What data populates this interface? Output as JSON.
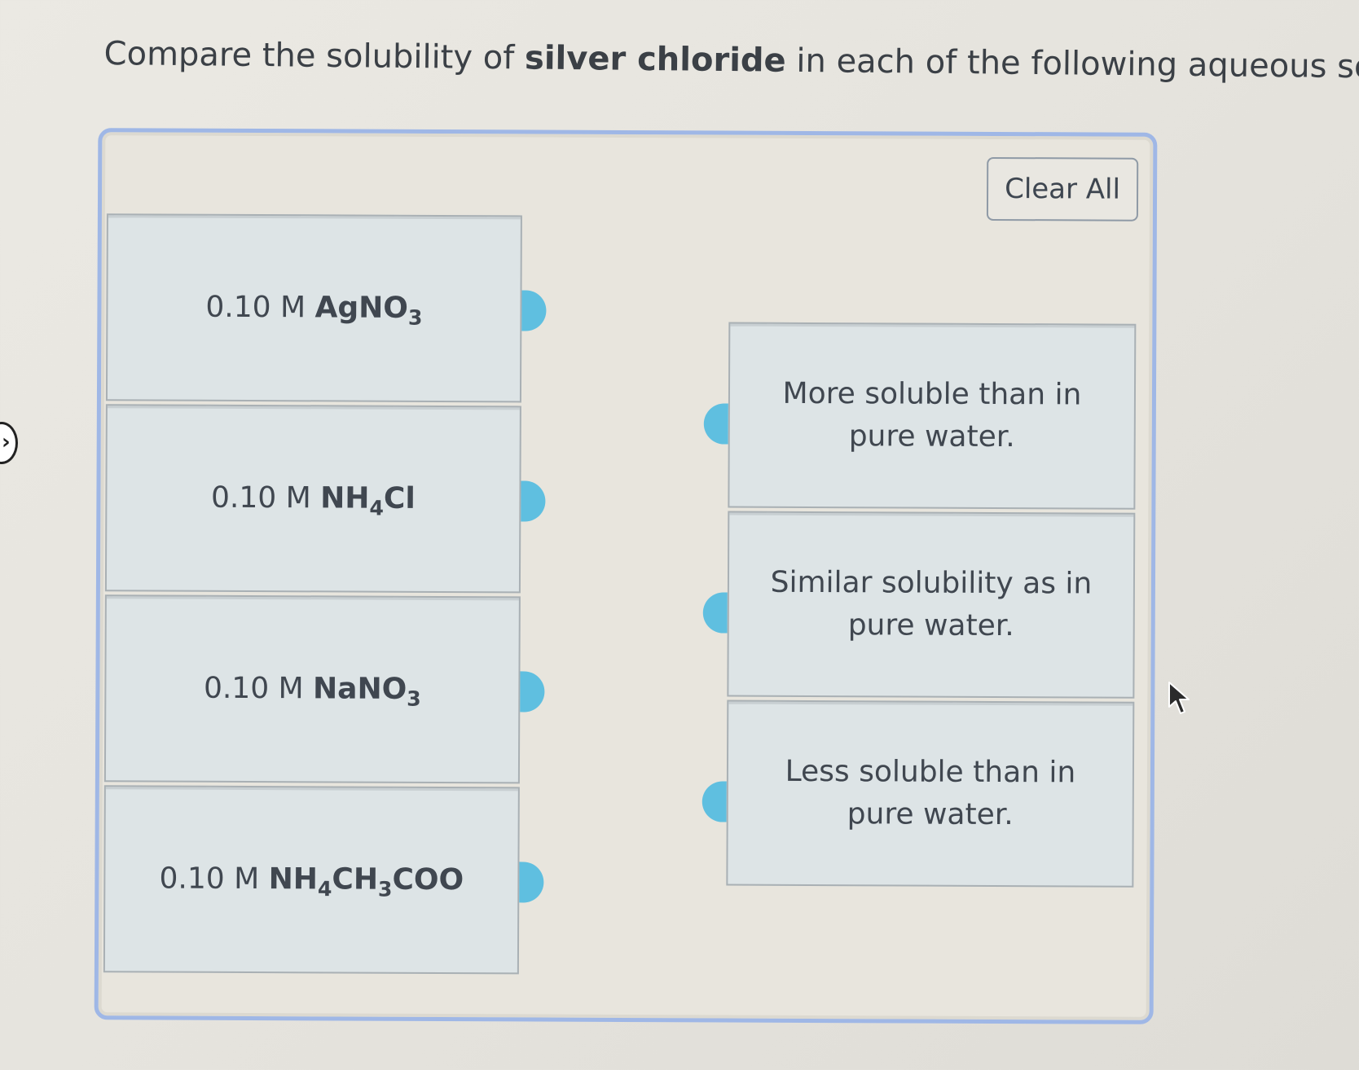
{
  "question": {
    "prefix": "Compare the solubility of ",
    "bold": "silver chloride",
    "suffix": " in each of the following aqueous solutions:"
  },
  "toolbar": {
    "clear_label": "Clear All"
  },
  "left_items": [
    {
      "prefix": "0.10 M ",
      "parts": [
        {
          "t": "AgNO"
        },
        {
          "s": "3"
        }
      ]
    },
    {
      "prefix": "0.10 M ",
      "parts": [
        {
          "t": "NH"
        },
        {
          "s": "4"
        },
        {
          "t": "Cl"
        }
      ]
    },
    {
      "prefix": "0.10 M ",
      "parts": [
        {
          "t": "NaNO"
        },
        {
          "s": "3"
        }
      ]
    },
    {
      "prefix": "0.10 M ",
      "parts": [
        {
          "t": "NH"
        },
        {
          "s": "4"
        },
        {
          "t": "CH"
        },
        {
          "s": "3"
        },
        {
          "t": "COO"
        }
      ]
    }
  ],
  "right_items": [
    {
      "line1": "More soluble than in",
      "line2": "pure water."
    },
    {
      "line1": "Similar solubility as in",
      "line2": "pure water."
    },
    {
      "line1": "Less soluble than in",
      "line2": "pure water."
    }
  ],
  "colors": {
    "panel_border": "#9fb7e6",
    "connector": "#5fbfe0",
    "item_bg": "#dde4e6"
  },
  "icons": {
    "side_handle": "side-handle-icon",
    "cursor": "mouse-pointer-icon"
  }
}
